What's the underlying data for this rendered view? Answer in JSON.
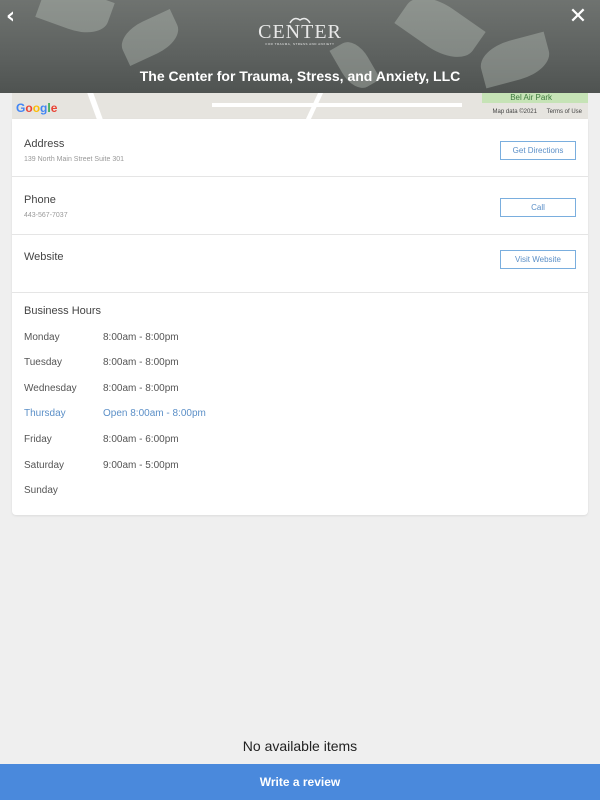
{
  "header": {
    "title": "The Center for Trauma, Stress, and Anxiety, LLC",
    "back_icon": "back-chevron-icon",
    "close_icon": "close-x-icon",
    "logo": {
      "word": "CENTER",
      "sub": "FOR TRAUMA, STRESS AND ANXIETY"
    }
  },
  "map": {
    "google_label": "Google",
    "park_label": "Bel Air Park",
    "map_data": "Map data ©2021",
    "terms": "Terms of Use"
  },
  "details": {
    "address": {
      "label": "Address",
      "value": "139 North Main Street Suite 301",
      "button": "Get Directions"
    },
    "phone": {
      "label": "Phone",
      "value": "443-567-7037",
      "button": "Call"
    },
    "website": {
      "label": "Website",
      "button": "Visit Website"
    }
  },
  "hours": {
    "title": "Business Hours",
    "days": [
      {
        "day": "Monday",
        "time": "8:00am - 8:00pm"
      },
      {
        "day": "Tuesday",
        "time": "8:00am - 8:00pm"
      },
      {
        "day": "Wednesday",
        "time": "8:00am - 8:00pm"
      },
      {
        "day": "Thursday",
        "time": "Open 8:00am - 8:00pm"
      },
      {
        "day": "Friday",
        "time": "8:00am - 6:00pm"
      },
      {
        "day": "Saturday",
        "time": "9:00am - 5:00pm"
      },
      {
        "day": "Sunday",
        "time": ""
      }
    ]
  },
  "reviews": {
    "empty_text": "No available items",
    "write_button": "Write a review"
  },
  "colors": {
    "accent": "#4a89dc",
    "today": "#5b8fc7",
    "button_border": "#7aaede"
  }
}
